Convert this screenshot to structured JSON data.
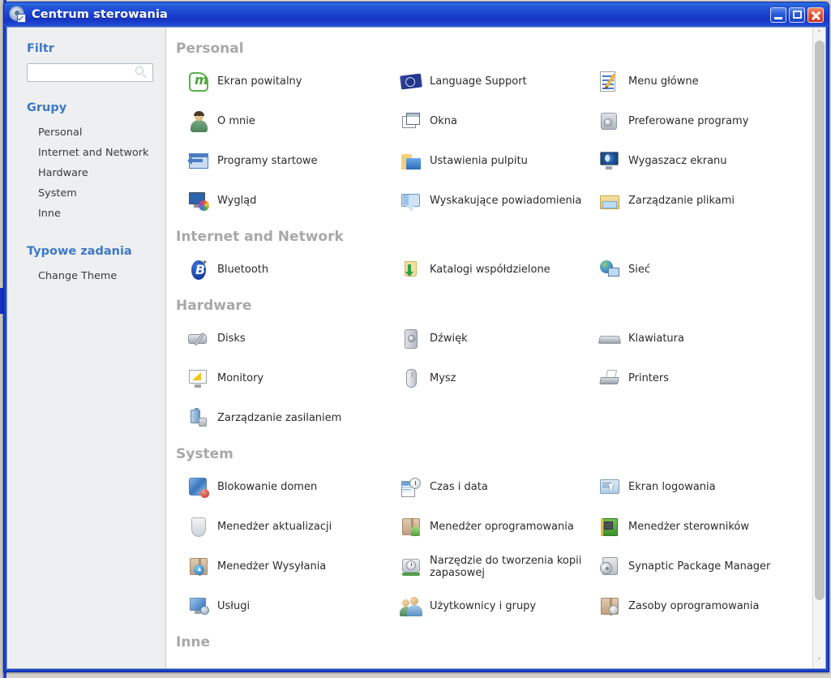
{
  "window": {
    "title": "Centrum sterowania",
    "title_icon": "control-center-icon",
    "minimize_label": "_",
    "maximize_label": "▢",
    "close_label": "✕"
  },
  "sidebar": {
    "filter_heading": "Filtr",
    "filter_value": "",
    "filter_placeholder": "",
    "search_icon": "search-icon",
    "groups_heading": "Grupy",
    "groups": [
      {
        "label": "Personal"
      },
      {
        "label": "Internet and Network"
      },
      {
        "label": "Hardware"
      },
      {
        "label": "System"
      },
      {
        "label": "Inne"
      }
    ],
    "common_tasks_heading": "Typowe zadania",
    "common_tasks": [
      {
        "label": "Change Theme"
      }
    ]
  },
  "content": {
    "sections": [
      {
        "title": "Personal",
        "items": [
          {
            "label": "Ekran powitalny",
            "icon": "linux-mint-logo-icon"
          },
          {
            "label": "Language Support",
            "icon": "un-flag-icon"
          },
          {
            "label": "Menu główne",
            "icon": "menu-edit-icon"
          },
          {
            "label": "O mnie",
            "icon": "user-person-icon"
          },
          {
            "label": "Okna",
            "icon": "windows-stack-icon"
          },
          {
            "label": "Preferowane programy",
            "icon": "preferred-apps-icon"
          },
          {
            "label": "Programy startowe",
            "icon": "startup-apps-icon"
          },
          {
            "label": "Ustawienia pulpitu",
            "icon": "desktop-settings-folder-icon"
          },
          {
            "label": "Wygaszacz ekranu",
            "icon": "screensaver-moon-icon"
          },
          {
            "label": "Wygląd",
            "icon": "appearance-monitor-icon"
          },
          {
            "label": "Wyskakujące powiadomienia",
            "icon": "notification-bubble-icon"
          },
          {
            "label": "Zarządzanie plikami",
            "icon": "file-management-folder-icon"
          }
        ]
      },
      {
        "title": "Internet and Network",
        "items": [
          {
            "label": "Bluetooth",
            "icon": "bluetooth-icon"
          },
          {
            "label": "Katalogi współdzielone",
            "icon": "shared-folders-icon"
          },
          {
            "label": "Sieć",
            "icon": "network-globe-icon"
          }
        ]
      },
      {
        "title": "Hardware",
        "items": [
          {
            "label": "Disks",
            "icon": "disks-icon"
          },
          {
            "label": "Dźwięk",
            "icon": "sound-speaker-icon"
          },
          {
            "label": "Klawiatura",
            "icon": "keyboard-icon"
          },
          {
            "label": "Monitory",
            "icon": "monitors-icon"
          },
          {
            "label": "Mysz",
            "icon": "mouse-icon"
          },
          {
            "label": "Printers",
            "icon": "printer-icon"
          },
          {
            "label": "Zarządzanie zasilaniem",
            "icon": "power-management-icon"
          }
        ]
      },
      {
        "title": "System",
        "items": [
          {
            "label": "Blokowanie domen",
            "icon": "domain-blocking-icon"
          },
          {
            "label": "Czas i data",
            "icon": "date-time-icon"
          },
          {
            "label": "Ekran logowania",
            "icon": "login-screen-icon"
          },
          {
            "label": "Menedżer aktualizacji",
            "icon": "update-manager-shield-icon"
          },
          {
            "label": "Menedżer oprogramowania",
            "icon": "software-manager-icon"
          },
          {
            "label": "Menedżer sterowników",
            "icon": "driver-manager-icon"
          },
          {
            "label": "Menedżer Wysyłania",
            "icon": "upload-manager-icon"
          },
          {
            "label": "Narzędzie do tworzenia kopii zapasowej",
            "icon": "backup-tool-icon"
          },
          {
            "label": "Synaptic Package Manager",
            "icon": "synaptic-icon"
          },
          {
            "label": "Usługi",
            "icon": "services-icon"
          },
          {
            "label": "Użytkownicy i grupy",
            "icon": "users-groups-icon"
          },
          {
            "label": "Zasoby oprogramowania",
            "icon": "software-sources-icon"
          }
        ]
      },
      {
        "title": "Inne",
        "items": []
      }
    ]
  },
  "scrollbar": {
    "up_arrow": "˄",
    "down_arrow": "˅"
  },
  "colors": {
    "titlebar_blue": "#1b41cf",
    "accent_link": "#3c78c8",
    "section_heading": "#a8a8a8",
    "sidebar_bg": "#eeeff0",
    "close_red": "#c8341c"
  }
}
